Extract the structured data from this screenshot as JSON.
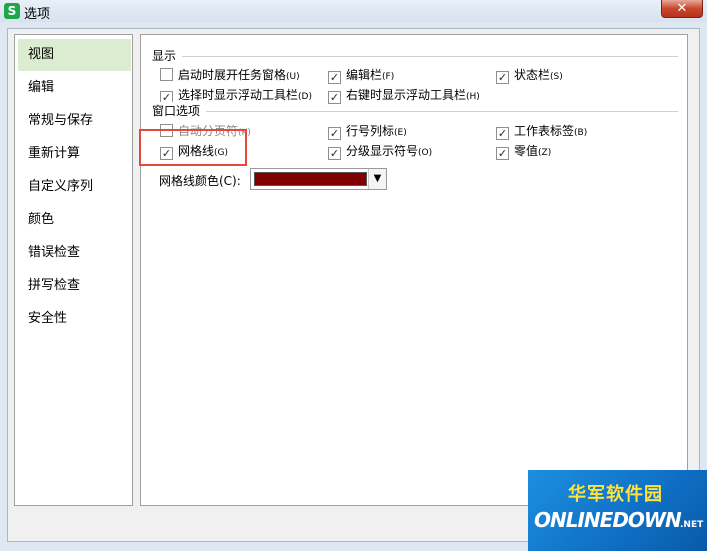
{
  "window": {
    "title": "选项",
    "app_icon": "S",
    "close_glyph": "✕"
  },
  "sidebar": {
    "items": [
      {
        "label": "视图",
        "active": true
      },
      {
        "label": "编辑"
      },
      {
        "label": "常规与保存"
      },
      {
        "label": "重新计算"
      },
      {
        "label": "自定义序列"
      },
      {
        "label": "颜色"
      },
      {
        "label": "错误检查"
      },
      {
        "label": "拼写检查"
      },
      {
        "label": "安全性"
      }
    ]
  },
  "display_section": {
    "title": "显示",
    "options": [
      {
        "label": "启动时展开任务窗格",
        "key": "(U)",
        "checked": false
      },
      {
        "label": "编辑栏",
        "key": "(F)",
        "checked": true
      },
      {
        "label": "状态栏",
        "key": "(S)",
        "checked": true
      },
      {
        "label": "选择时显示浮动工具栏",
        "key": "(D)",
        "checked": true
      },
      {
        "label": "右键时显示浮动工具栏",
        "key": "(H)",
        "checked": true
      }
    ]
  },
  "window_section": {
    "title": "窗口选项",
    "options": [
      {
        "label": "自动分页符",
        "key": "(K)",
        "checked": false
      },
      {
        "label": "行号列标",
        "key": "(E)",
        "checked": true
      },
      {
        "label": "工作表标签",
        "key": "(B)",
        "checked": true
      },
      {
        "label": "网格线",
        "key": "(G)",
        "checked": true
      },
      {
        "label": "分级显示符号",
        "key": "(O)",
        "checked": true
      },
      {
        "label": "零值",
        "key": "(Z)",
        "checked": true
      }
    ]
  },
  "grid_color": {
    "label": "网格线颜色(C):",
    "value_color": "#800000"
  },
  "colors": {
    "accent_highlight": "#e8463a",
    "nav_active_bg": "#dcecd1"
  },
  "watermark": {
    "cn": "华军软件园",
    "en": "ONLINEDOWN",
    "suffix": ".NET"
  }
}
